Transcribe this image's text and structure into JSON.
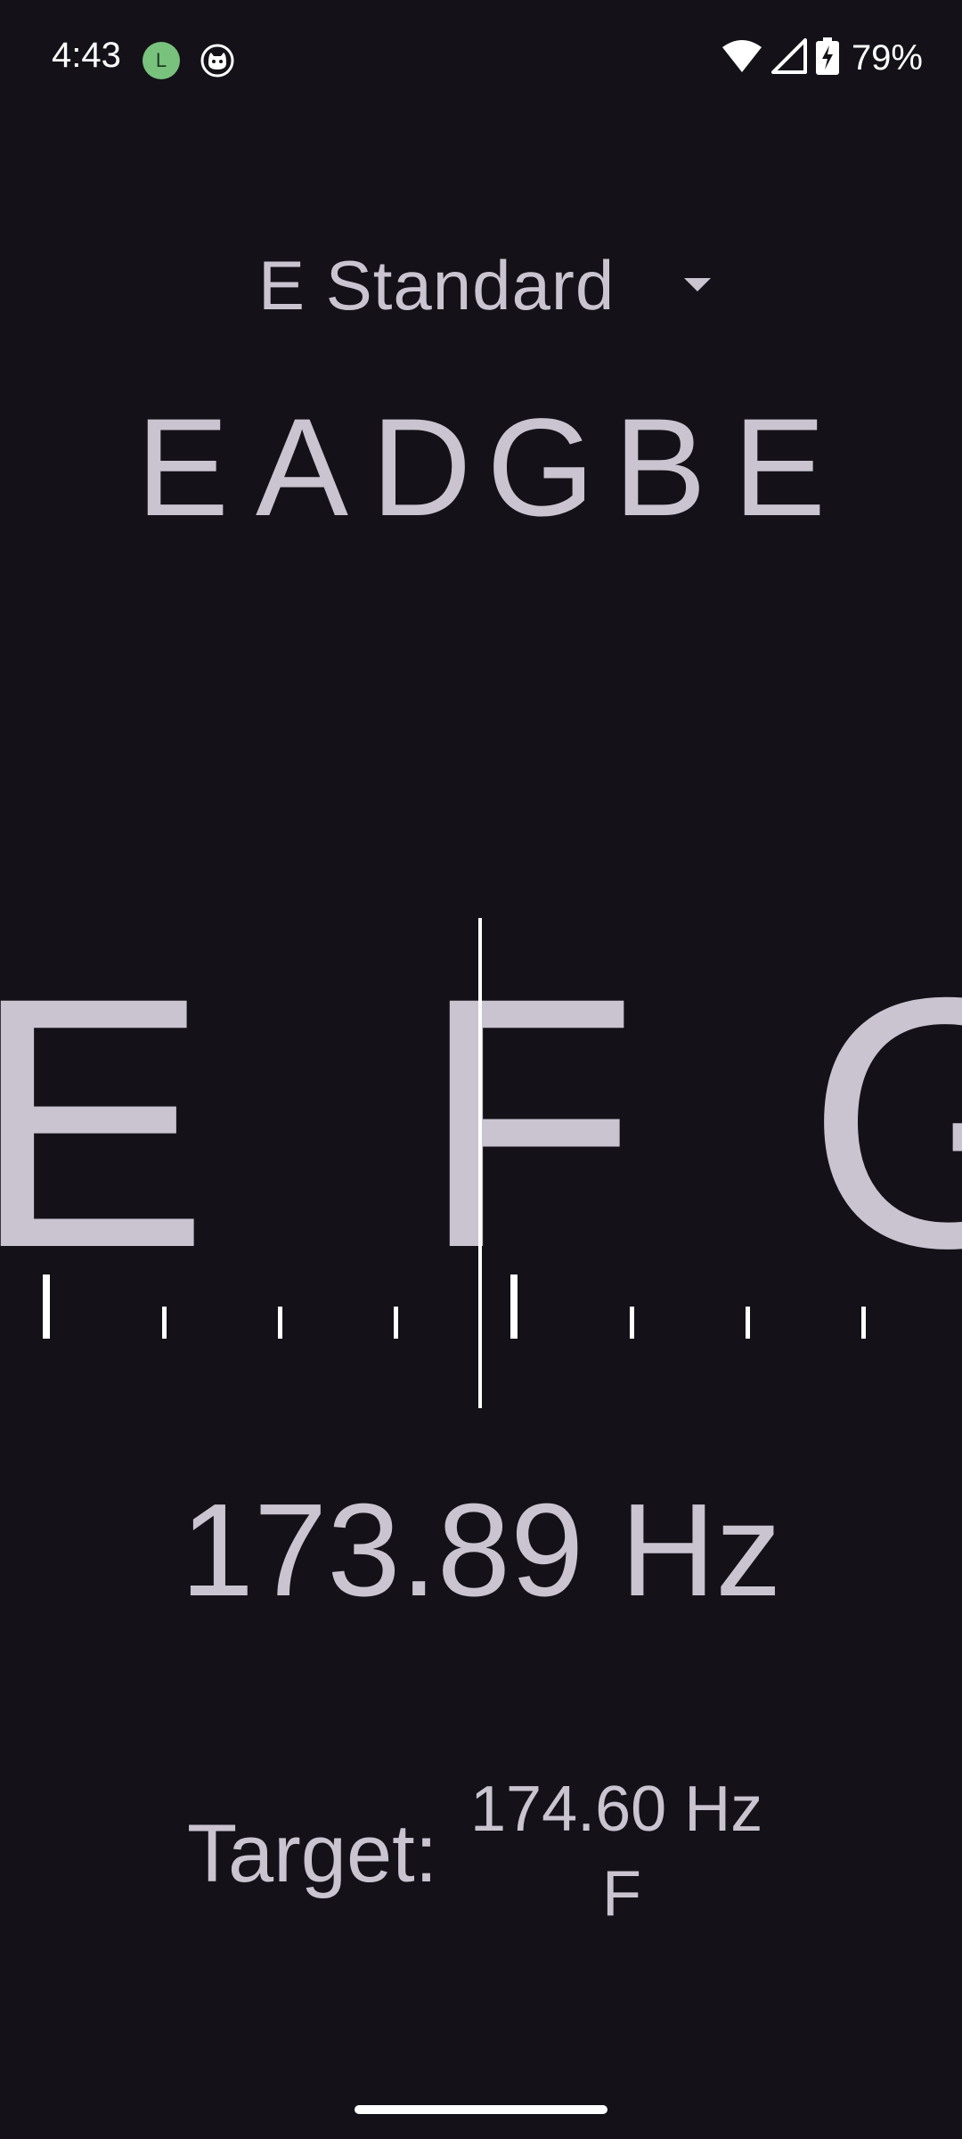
{
  "status_bar": {
    "time": "4:43",
    "app_badge_letter": "L",
    "battery": "79%",
    "icons": [
      "app-badge-icon",
      "cat-icon",
      "wifi-icon",
      "signal-icon",
      "battery-charging-icon"
    ]
  },
  "tuning": {
    "name": "E Standard",
    "strings": [
      "E",
      "A",
      "D",
      "G",
      "B",
      "E"
    ]
  },
  "dial": {
    "prev_note": "E",
    "current_note": "F",
    "next_note": "G"
  },
  "frequency": "173.89 Hz",
  "target": {
    "label": "Target:",
    "frequency": "174.60 Hz",
    "note": "F"
  },
  "colors": {
    "background": "#141218",
    "text": "#cac4d0",
    "needle": "#ffffff",
    "badge": "#78c27e"
  }
}
